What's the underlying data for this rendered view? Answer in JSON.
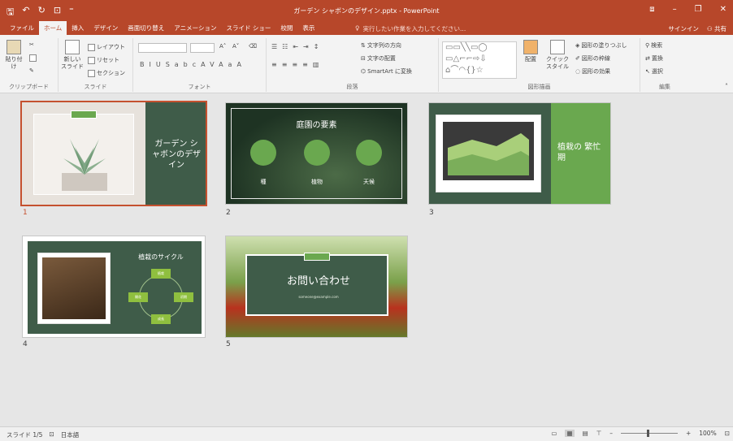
{
  "title_bar": {
    "filename": "ガーデン シャボンのデザイン.pptx - PowerPoint"
  },
  "tabs": [
    "ファイル",
    "ホーム",
    "挿入",
    "デザイン",
    "画面切り替え",
    "アニメーション",
    "スライド ショー",
    "校閲",
    "表示"
  ],
  "search_hint": "実行したい作業を入力してください...",
  "account": {
    "signin": "サインイン",
    "share": "共有"
  },
  "ribbon": {
    "clipboard": {
      "label": "クリップボード",
      "paste": "貼り付け"
    },
    "slides": {
      "label": "スライド",
      "new_slide": "新しい スライド",
      "layout": "レイアウト",
      "reset": "リセット",
      "section": "セクション"
    },
    "font": {
      "label": "フォント"
    },
    "paragraph": {
      "label": "段落",
      "text_direction": "文字列の方向",
      "align_text": "文字の配置",
      "smartart": "SmartArt に変換"
    },
    "drawing": {
      "label": "図形描画",
      "arrange": "配置",
      "quick_styles": "クイック スタイル",
      "shape_fill": "図形の塗りつぶし",
      "shape_outline": "図形の枠線",
      "shape_effects": "図形の効果"
    },
    "editing": {
      "label": "編集",
      "find": "検索",
      "replace": "置換",
      "select": "選択"
    }
  },
  "slides": [
    {
      "num": "1",
      "title": "ガーデン シャボンのデザイン"
    },
    {
      "num": "2",
      "title": "庭園の要素",
      "items": [
        "種",
        "植物",
        "天候"
      ]
    },
    {
      "num": "3",
      "title": "植栽の 繁忙期"
    },
    {
      "num": "4",
      "title": "植栽のサイクル",
      "cycle": [
        "植栽",
        "初期",
        "成長",
        "開花"
      ]
    },
    {
      "num": "5",
      "title": "お問い合わせ",
      "email": "someone@example.com"
    }
  ],
  "status": {
    "slide_indicator": "スライド 1/5",
    "language": "日本語",
    "zoom": "100%"
  },
  "colors": {
    "accent": "#b7472a",
    "slide_green": "#3f5c49",
    "leaf_green": "#6aa84f",
    "selection": "#c5512f"
  }
}
